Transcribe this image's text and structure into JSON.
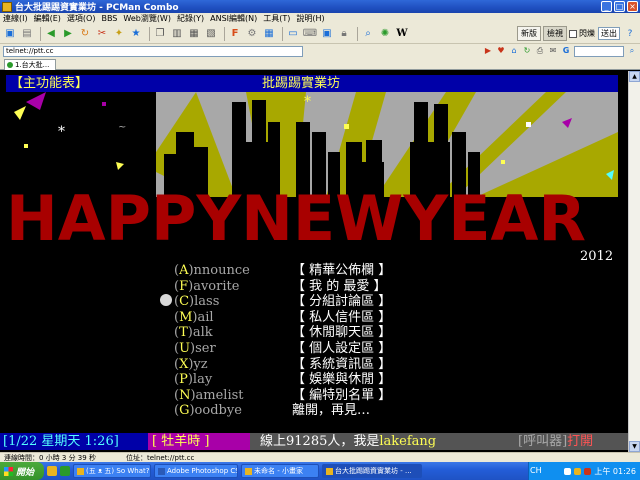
{
  "window": {
    "title": "台大批踢踢資實業坊 - PCMan Combo"
  },
  "menu": [
    "連線(I)",
    "編輯(E)",
    "選項(O)",
    "BBS",
    "Web瀏覽(W)",
    "紀錄(Y)",
    "ANSI編輯(N)",
    "工具(T)",
    "說明(H)"
  ],
  "toolbar": {
    "btn_new": "新版",
    "btn_view": "檢視",
    "chk_label": "閃爍",
    "select_label": "送出"
  },
  "address": {
    "value": "telnet://ptt.cc"
  },
  "tabs": [
    {
      "label": "1.台大批..."
    }
  ],
  "terminal": {
    "header_left": "【主功能表】",
    "header_center": "批踢踢實業坊",
    "year": "2012",
    "art_text": "HAPPYNEWYEAR",
    "menu_items": [
      {
        "paren_open": "(",
        "key": "A",
        "paren_close": ")",
        "rest": "nnounce",
        "desc": "【 精華公佈欄 】"
      },
      {
        "paren_open": "(",
        "key": "F",
        "paren_close": ")",
        "rest": "avorite",
        "desc": "【 我 的 最愛 】"
      },
      {
        "paren_open": "(",
        "key": "C",
        "paren_close": ")",
        "rest": "lass",
        "desc": "【 分組討論區 】"
      },
      {
        "paren_open": "(",
        "key": "M",
        "paren_close": ")",
        "rest": "ail",
        "desc": "【 私人信件區 】"
      },
      {
        "paren_open": "(",
        "key": "T",
        "paren_close": ")",
        "rest": "alk",
        "desc": "【 休閒聊天區 】"
      },
      {
        "paren_open": "(",
        "key": "U",
        "paren_close": ")",
        "rest": "ser",
        "desc": "【 個人設定區 】"
      },
      {
        "paren_open": "(",
        "key": "X",
        "paren_close": ")",
        "rest": "yz",
        "desc": "【 系統資訊區 】"
      },
      {
        "paren_open": "(",
        "key": "P",
        "paren_close": ")",
        "rest": "lay",
        "desc": "【 娛樂與休閒 】"
      },
      {
        "paren_open": "(",
        "key": "N",
        "paren_close": ")",
        "rest": "amelist",
        "desc": "【 編特別名單 】"
      },
      {
        "paren_open": "(",
        "key": "G",
        "paren_close": ")",
        "rest": "oodbye",
        "desc": "   離開，再見…"
      }
    ],
    "status": {
      "date": "[1/22 星期天 1:26]",
      "time": "[ 牡羊時 ]",
      "online_prefix": "線上91285人，我是",
      "user": "lakefang",
      "call_label": "[呼叫器]",
      "call_state": "打開"
    }
  },
  "statusbar": {
    "connection": "連線時間：0 小時 3 分 39 秒",
    "location": "位址：telnet://ptt.cc"
  },
  "taskbar": {
    "start": "開始",
    "buttons": [
      "(五 ᴥ 五) So What? -...",
      "Adobe Photoshop CS3...",
      "未命名 - 小畫家",
      "台大批踢踢資實業坊 - ..."
    ],
    "lang": "CH",
    "clock": "上午 01:26"
  }
}
